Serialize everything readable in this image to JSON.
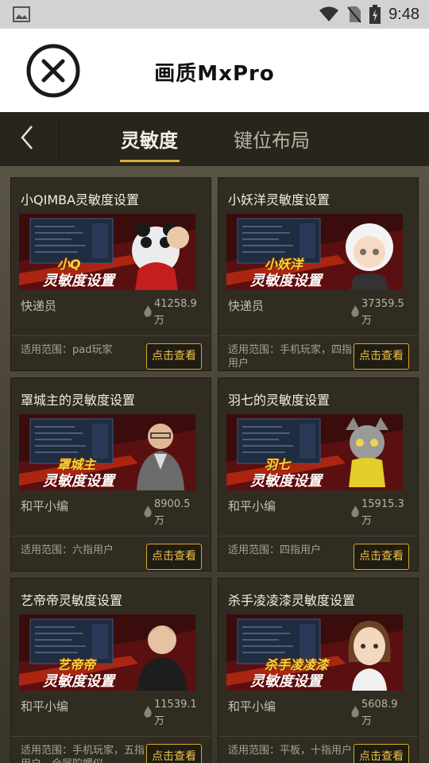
{
  "status_bar": {
    "time": "9:48"
  },
  "app_bar": {
    "title": "画质MxPro"
  },
  "tabs": [
    {
      "label": "灵敏度",
      "active": true
    },
    {
      "label": "键位布局",
      "active": false
    }
  ],
  "cards": [
    {
      "title": "小QIMBA灵敏度设置",
      "banner_name": "小Q",
      "banner_subtitle": "灵敏度设置",
      "author": "快递员",
      "views": "41258.9万",
      "views_line1": "41258.9",
      "views_line2": "万",
      "scope": "适用范围：pad玩家",
      "button": "点击查看"
    },
    {
      "title": "小妖洋灵敏度设置",
      "banner_name": "小妖洋",
      "banner_subtitle": "灵敏度设置",
      "author": "快递员",
      "views": "37359.5万",
      "views_line1": "37359.5",
      "views_line2": "万",
      "scope": "适用范围：手机玩家，四指用户",
      "button": "点击查看"
    },
    {
      "title": "罩城主的灵敏度设置",
      "banner_name": "罩城主",
      "banner_subtitle": "灵敏度设置",
      "author": "和平小编",
      "views": "8900.5万",
      "views_line1": "8900.5",
      "views_line2": "万",
      "scope": "适用范围：六指用户",
      "button": "点击查看"
    },
    {
      "title": "羽七的灵敏度设置",
      "banner_name": "羽七",
      "banner_subtitle": "灵敏度设置",
      "author": "和平小编",
      "views": "15915.3万",
      "views_line1": "15915.3",
      "views_line2": "万",
      "scope": "适用范围：四指用户",
      "button": "点击查看"
    },
    {
      "title": "艺帝帝灵敏度设置",
      "banner_name": "艺帝帝",
      "banner_subtitle": "灵敏度设置",
      "author": "和平小编",
      "views": "11539.1万",
      "views_line1": "11539.1",
      "views_line2": "万",
      "scope": "适用范围：手机玩家，五指用户，全层陀螺仪",
      "button": "点击查看"
    },
    {
      "title": "杀手凌凌漆灵敏度设置",
      "banner_name": "杀手凌凌漆",
      "banner_subtitle": "灵敏度设置",
      "author": "和平小编",
      "views": "5608.9万",
      "views_line1": "5608.9",
      "views_line2": "万",
      "scope": "适用范围：平板，十指用户",
      "button": "点击查看"
    }
  ],
  "colors": {
    "accent": "#d6a72c",
    "button_text": "#eec24a",
    "tab_underline": "#d8b13c",
    "card_bg": "#302c21"
  },
  "icons": {
    "gallery": "image-icon",
    "wifi": "wifi-icon",
    "no_sim": "no-sim-icon",
    "battery": "battery-charging-icon",
    "close": "close-circle-icon",
    "back": "chevron-left-icon",
    "views": "flame-icon"
  }
}
